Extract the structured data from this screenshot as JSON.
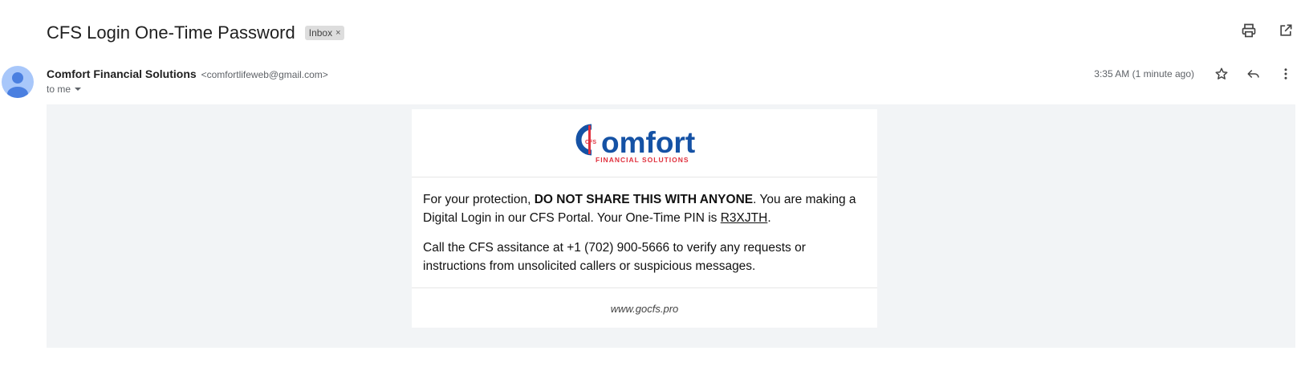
{
  "email": {
    "subject": "CFS Login One-Time Password",
    "label": "Inbox",
    "label_close": "×",
    "sender_name": "Comfort Financial Solutions",
    "sender_email": "<comfortlifeweb@gmail.com>",
    "recipient": "to me",
    "timestamp": "3:35 AM (1 minute ago)"
  },
  "icons": {
    "print": "print-icon",
    "open_new_window": "open-in-new-window-icon",
    "star": "star-icon",
    "reply": "reply-icon",
    "more": "more-vert-icon",
    "dropdown": "chevron-down-icon",
    "avatar": "person-avatar-icon"
  },
  "body": {
    "logo_text": "omfort",
    "logo_monogram": "CFS",
    "logo_tagline": "FINANCIAL SOLUTIONS",
    "para1_prefix": "For your protection, ",
    "para1_bold": "DO NOT SHARE THIS WITH ANYONE",
    "para1_middle": ". You are making a Digital Login in our CFS Portal. Your One-Time PIN is ",
    "pin": "R3XJTH",
    "para1_end": ".",
    "para2": "Call the CFS assitance at +1 (702) 900-5666 to verify any requests or instructions from unsolicited callers or suspicious messages.",
    "footer_link": "www.gocfs.pro"
  },
  "colors": {
    "logo_blue": "#1552a5",
    "logo_red": "#e0303d",
    "body_bg": "#f2f4f6",
    "avatar_bg": "#a8c7fa",
    "avatar_fg": "#4a7fe0"
  }
}
